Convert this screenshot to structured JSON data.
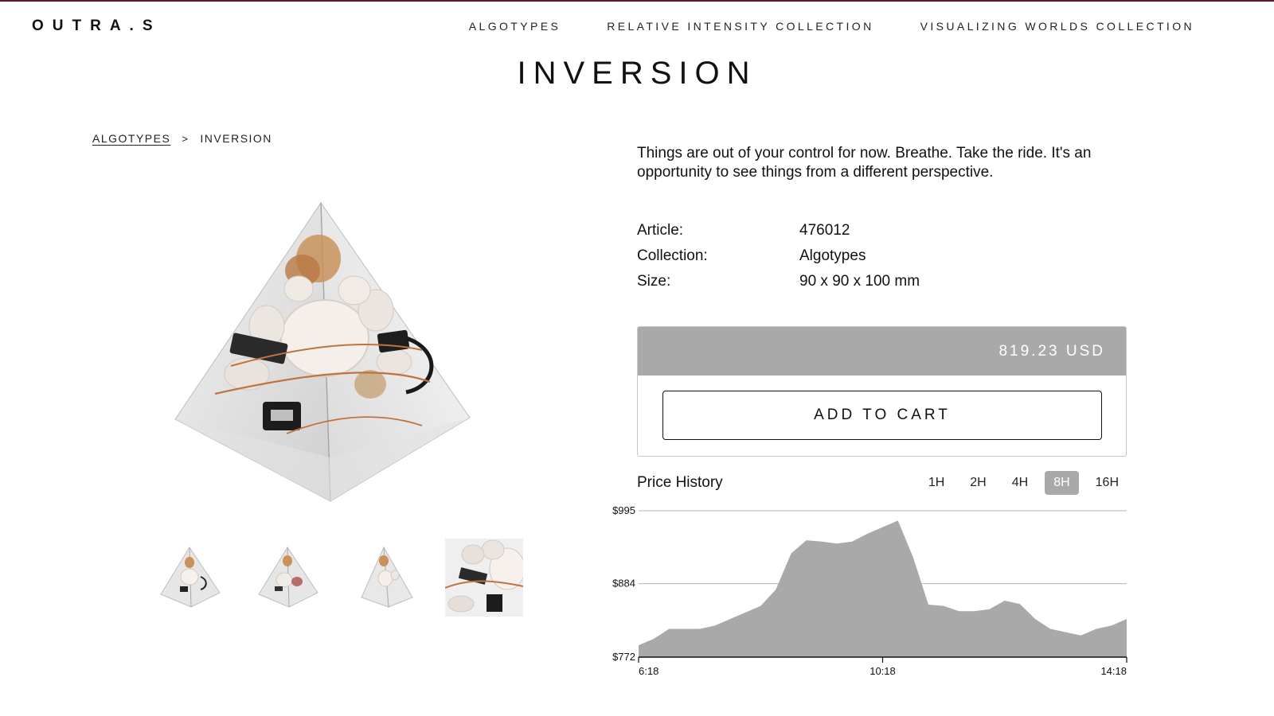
{
  "header": {
    "logo": "OUTRA.S",
    "nav": [
      "ALGOTYPES",
      "RELATIVE INTENSITY COLLECTION",
      "VISUALIZING WORLDS COLLECTION"
    ]
  },
  "page_title": "INVERSION",
  "breadcrumb": {
    "parent": "ALGOTYPES",
    "separator": ">",
    "current": "INVERSION"
  },
  "description": "Things are out of your control for now. Breathe. Take the ride. It's an opportunity to see things from a different perspective.",
  "specs": [
    {
      "key": "Article:",
      "value": "476012"
    },
    {
      "key": "Collection:",
      "value": "Algotypes"
    },
    {
      "key": "Size:",
      "value": "90 x 90 x 100 mm"
    }
  ],
  "price": "819.23 USD",
  "add_to_cart": "ADD TO CART",
  "price_history": {
    "title": "Price History",
    "ranges": [
      "1H",
      "2H",
      "4H",
      "8H",
      "16H"
    ],
    "active_range": "8H"
  },
  "colors": {
    "accent_bar": "#5a1a2e",
    "price_bar": "#a9a9a9",
    "chart_fill": "#a9a9a9"
  },
  "chart_data": {
    "type": "area",
    "title": "",
    "xlabel": "",
    "ylabel": "",
    "yticks": [
      "$995",
      "$884",
      "$772"
    ],
    "ylim": [
      772,
      995
    ],
    "xticks": [
      "6:18",
      "10:18",
      "14:18"
    ],
    "x": [
      "6:18",
      "6:33",
      "6:48",
      "7:03",
      "7:18",
      "7:33",
      "7:48",
      "8:03",
      "8:18",
      "8:33",
      "8:48",
      "9:03",
      "9:18",
      "9:33",
      "9:48",
      "10:03",
      "10:18",
      "10:33",
      "10:48",
      "11:03",
      "11:18",
      "11:33",
      "11:48",
      "12:03",
      "12:18",
      "12:33",
      "12:48",
      "13:03",
      "13:18",
      "13:33",
      "13:48",
      "14:03",
      "14:18"
    ],
    "series": [
      {
        "values": [
          790,
          800,
          815,
          815,
          815,
          820,
          830,
          840,
          850,
          875,
          930,
          950,
          948,
          945,
          948,
          960,
          970,
          980,
          924,
          852,
          850,
          842,
          842,
          845,
          858,
          853,
          830,
          815,
          810,
          805,
          815,
          820,
          830
        ]
      }
    ]
  }
}
